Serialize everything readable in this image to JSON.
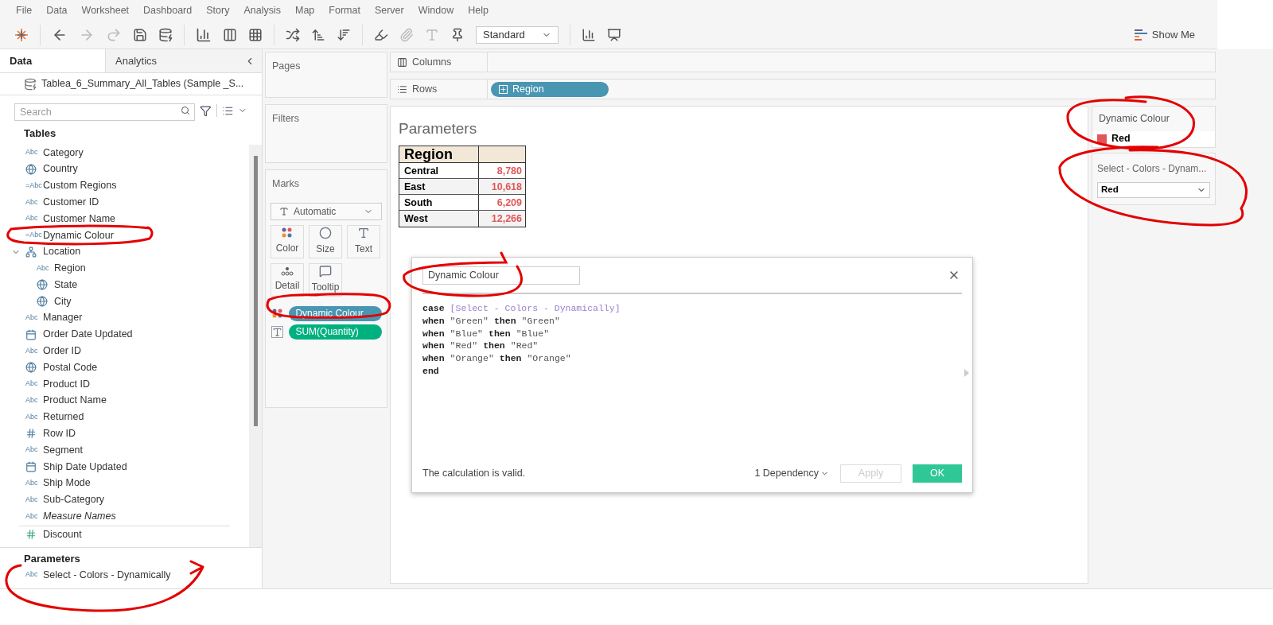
{
  "menu": [
    "File",
    "Data",
    "Worksheet",
    "Dashboard",
    "Story",
    "Analysis",
    "Map",
    "Format",
    "Server",
    "Window",
    "Help"
  ],
  "toolbar": {
    "fit": "Standard",
    "show_me": "Show Me"
  },
  "data_pane": {
    "tabs": [
      {
        "label": "Data",
        "selected": true
      },
      {
        "label": "Analytics",
        "selected": false
      }
    ],
    "datasource": "Tablea_6_Summary_All_Tables (Sample _S...",
    "search": {
      "placeholder": "Search"
    },
    "tables_heading": "Tables",
    "fields": [
      {
        "name": "Category",
        "kind": "abc",
        "icon_text": "Abc",
        "italic": false
      },
      {
        "name": "Country",
        "kind": "globe",
        "italic": false
      },
      {
        "name": "Custom Regions",
        "kind": "calc",
        "icon_text": "=Abc",
        "italic": false
      },
      {
        "name": "Customer ID",
        "kind": "abc",
        "icon_text": "Abc",
        "italic": false
      },
      {
        "name": "Customer Name",
        "kind": "abc",
        "icon_text": "Abc",
        "italic": false
      },
      {
        "name": "Dynamic Colour",
        "kind": "calc",
        "icon_text": "=Abc",
        "italic": false
      },
      {
        "name": "Location",
        "kind": "hierarchy",
        "italic": false,
        "expanded": true,
        "children": [
          {
            "name": "Region",
            "kind": "abc",
            "icon_text": "Abc",
            "italic": false
          },
          {
            "name": "State",
            "kind": "globe",
            "italic": false
          },
          {
            "name": "City",
            "kind": "globe",
            "italic": false
          }
        ]
      },
      {
        "name": "Manager",
        "kind": "abc",
        "icon_text": "Abc",
        "italic": false
      },
      {
        "name": "Order Date Updated",
        "kind": "date",
        "italic": false
      },
      {
        "name": "Order ID",
        "kind": "abc",
        "icon_text": "Abc",
        "italic": false
      },
      {
        "name": "Postal Code",
        "kind": "globe",
        "italic": false
      },
      {
        "name": "Product ID",
        "kind": "abc",
        "icon_text": "Abc",
        "italic": false
      },
      {
        "name": "Product Name",
        "kind": "abc",
        "icon_text": "Abc",
        "italic": false
      },
      {
        "name": "Returned",
        "kind": "abc",
        "icon_text": "Abc",
        "italic": false
      },
      {
        "name": "Row ID",
        "kind": "number",
        "italic": false
      },
      {
        "name": "Segment",
        "kind": "abc",
        "icon_text": "Abc",
        "italic": false
      },
      {
        "name": "Ship Date Updated",
        "kind": "date",
        "italic": false
      },
      {
        "name": "Ship Mode",
        "kind": "abc",
        "icon_text": "Abc",
        "italic": false
      },
      {
        "name": "Sub-Category",
        "kind": "abc",
        "icon_text": "Abc",
        "italic": false
      },
      {
        "name": "Measure Names",
        "kind": "abc",
        "icon_text": "Abc",
        "italic": true
      }
    ],
    "measures": [
      {
        "name": "Discount",
        "kind": "measure",
        "italic": false
      }
    ],
    "parameters_heading": "Parameters",
    "parameters": [
      {
        "name": "Select - Colors - Dynamically",
        "kind": "abc",
        "icon_text": "Abc",
        "italic": false
      }
    ]
  },
  "shelves": {
    "pages": "Pages",
    "filters": "Filters",
    "columns": "Columns",
    "rows": "Rows",
    "row_pills": [
      "Region"
    ]
  },
  "marks": {
    "title": "Marks",
    "mark_type": "Automatic",
    "cards": [
      {
        "label": "Color",
        "kind": "color"
      },
      {
        "label": "Size",
        "kind": "size"
      },
      {
        "label": "Text",
        "kind": "text"
      },
      {
        "label": "Detail",
        "kind": "detail"
      },
      {
        "label": "Tooltip",
        "kind": "tooltip"
      }
    ],
    "pills": [
      {
        "label": "Dynamic Colour",
        "kind": "color",
        "color": "#4996b2"
      },
      {
        "label": "SUM(Quantity)",
        "kind": "text",
        "color": "#00b180"
      }
    ]
  },
  "view": {
    "title": "Parameters",
    "header": "Region",
    "rows": [
      {
        "region": "Central",
        "value": "8,780"
      },
      {
        "region": "East",
        "value": "10,618"
      },
      {
        "region": "South",
        "value": "6,209"
      },
      {
        "region": "West",
        "value": "12,266"
      }
    ]
  },
  "dialog": {
    "name": "Dynamic Colour",
    "code": [
      [
        {
          "kind": "keyword",
          "text": "case"
        },
        {
          "kind": "field",
          "text": "[Select - Colors - Dynamically]"
        }
      ],
      [
        {
          "kind": "keyword",
          "text": "when"
        },
        {
          "kind": "string",
          "text": "\"Green\""
        },
        {
          "kind": "keyword",
          "text": "then"
        },
        {
          "kind": "string",
          "text": "\"Green\""
        }
      ],
      [
        {
          "kind": "keyword",
          "text": "when"
        },
        {
          "kind": "string",
          "text": "\"Blue\""
        },
        {
          "kind": "keyword",
          "text": "then"
        },
        {
          "kind": "string",
          "text": "\"Blue\""
        }
      ],
      [
        {
          "kind": "keyword",
          "text": "when"
        },
        {
          "kind": "string",
          "text": "\"Red\""
        },
        {
          "kind": "keyword",
          "text": "then"
        },
        {
          "kind": "string",
          "text": "\"Red\""
        }
      ],
      [
        {
          "kind": "keyword",
          "text": "when"
        },
        {
          "kind": "string",
          "text": "\"Orange\""
        },
        {
          "kind": "keyword",
          "text": "then"
        },
        {
          "kind": "string",
          "text": "\"Orange\""
        }
      ],
      [
        {
          "kind": "keyword",
          "text": "end"
        }
      ]
    ],
    "status": "The calculation is valid.",
    "dependency": "1 Dependency",
    "apply": {
      "label": "Apply",
      "disabled": true
    },
    "ok": "OK"
  },
  "legend": {
    "title": "Dynamic Colour",
    "items": [
      {
        "label": "Red",
        "color": "#e15759"
      }
    ]
  },
  "parameter_control": {
    "title": "Select - Colors - Dynam...",
    "value": "Red"
  }
}
